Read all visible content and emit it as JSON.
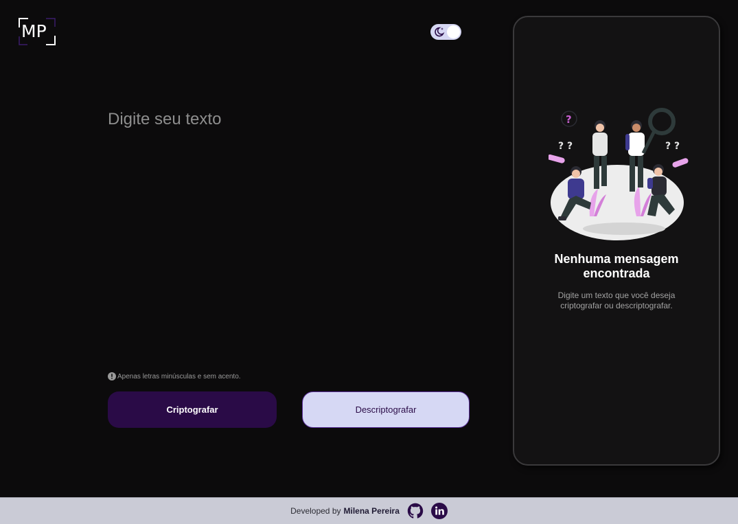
{
  "header": {
    "logo_text": "MP",
    "theme_toggle": {
      "state": "dark",
      "icon": "moon-icon"
    }
  },
  "input": {
    "placeholder": "Digite seu texto",
    "value": ""
  },
  "hint": {
    "icon": "exclamation-icon",
    "text": "Apenas letras minúsculas e sem acento."
  },
  "buttons": {
    "encrypt_label": "Criptografar",
    "decrypt_label": "Descriptografar"
  },
  "output": {
    "title": "Nenhuma mensagem encontrada",
    "description": "Digite um texto que você deseja criptografar ou descriptografar.",
    "illustration": "people-searching-illustration"
  },
  "footer": {
    "prefix": "Developed by",
    "author": "Milena Pereira",
    "links": [
      {
        "name": "github",
        "icon": "github-icon"
      },
      {
        "name": "linkedin",
        "icon": "linkedin-icon"
      }
    ]
  },
  "colors": {
    "background": "#0c0b0c",
    "accent_dark": "#2a0b47",
    "accent_light": "#d6d8f4",
    "panel": "#131213",
    "footer": "#cacbd6"
  }
}
